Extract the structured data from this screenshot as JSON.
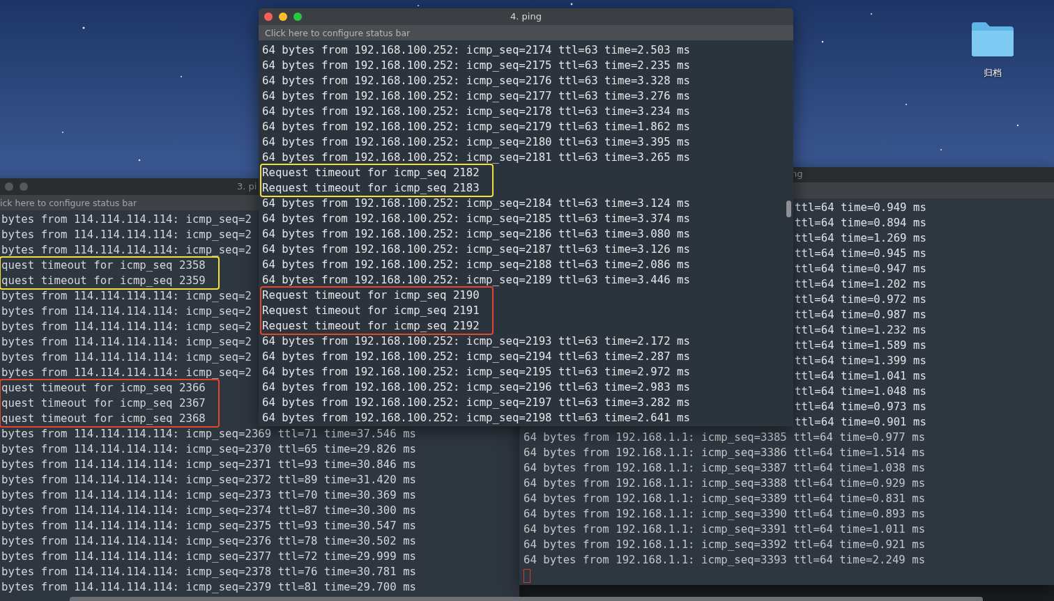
{
  "desktop": {
    "kind": "picture",
    "icons": [
      {
        "label": "归档"
      }
    ]
  },
  "windows": [
    {
      "title": "4. ping",
      "active": true,
      "status_bar": "Click here to configure status bar",
      "blocks": [
        {
          "lines": [
            "64 bytes from 192.168.100.252: icmp_seq=2174 ttl=63 time=2.503 ms",
            "64 bytes from 192.168.100.252: icmp_seq=2175 ttl=63 time=2.235 ms",
            "64 bytes from 192.168.100.252: icmp_seq=2176 ttl=63 time=3.328 ms",
            "64 bytes from 192.168.100.252: icmp_seq=2177 ttl=63 time=3.276 ms",
            "64 bytes from 192.168.100.252: icmp_seq=2178 ttl=63 time=3.234 ms",
            "64 bytes from 192.168.100.252: icmp_seq=2179 ttl=63 time=1.862 ms",
            "64 bytes from 192.168.100.252: icmp_seq=2180 ttl=63 time=3.395 ms",
            "64 bytes from 192.168.100.252: icmp_seq=2181 ttl=63 time=3.265 ms"
          ]
        },
        {
          "color": "#f2e13c",
          "lines": [
            "Request timeout for icmp_seq 2182",
            "Request timeout for icmp_seq 2183"
          ]
        },
        {
          "lines": [
            "64 bytes from 192.168.100.252: icmp_seq=2184 ttl=63 time=3.124 ms",
            "64 bytes from 192.168.100.252: icmp_seq=2185 ttl=63 time=3.374 ms",
            "64 bytes from 192.168.100.252: icmp_seq=2186 ttl=63 time=3.080 ms",
            "64 bytes from 192.168.100.252: icmp_seq=2187 ttl=63 time=3.126 ms",
            "64 bytes from 192.168.100.252: icmp_seq=2188 ttl=63 time=2.086 ms",
            "64 bytes from 192.168.100.252: icmp_seq=2189 ttl=63 time=3.446 ms"
          ]
        },
        {
          "color": "#e5462b",
          "lines": [
            "Request timeout for icmp_seq 2190",
            "Request timeout for icmp_seq 2191",
            "Request timeout for icmp_seq 2192"
          ]
        },
        {
          "lines": [
            "64 bytes from 192.168.100.252: icmp_seq=2193 ttl=63 time=2.172 ms",
            "64 bytes from 192.168.100.252: icmp_seq=2194 ttl=63 time=2.287 ms",
            "64 bytes from 192.168.100.252: icmp_seq=2195 ttl=63 time=2.972 ms",
            "64 bytes from 192.168.100.252: icmp_seq=2196 ttl=63 time=2.983 ms",
            "64 bytes from 192.168.100.252: icmp_seq=2197 ttl=63 time=3.282 ms",
            "64 bytes from 192.168.100.252: icmp_seq=2198 ttl=63 time=2.641 ms"
          ]
        }
      ]
    },
    {
      "title": "3. pi",
      "active": false,
      "status_bar": "ick here to configure status bar",
      "blocks": [
        {
          "lines": [
            "bytes from 114.114.114.114: icmp_seq=2",
            "bytes from 114.114.114.114: icmp_seq=2",
            "bytes from 114.114.114.114: icmp_seq=2"
          ]
        },
        {
          "color": "#f2e13c",
          "lines": [
            "quest timeout for icmp_seq 2358",
            "quest timeout for icmp_seq 2359"
          ]
        },
        {
          "lines": [
            "bytes from 114.114.114.114: icmp_seq=2",
            "bytes from 114.114.114.114: icmp_seq=2",
            "bytes from 114.114.114.114: icmp_seq=2",
            "bytes from 114.114.114.114: icmp_seq=2",
            "bytes from 114.114.114.114: icmp_seq=2",
            "bytes from 114.114.114.114: icmp_seq=2"
          ]
        },
        {
          "color": "#e5462b",
          "lines": [
            "quest timeout for icmp_seq 2366",
            "quest timeout for icmp_seq 2367",
            "quest timeout for icmp_seq 2368"
          ]
        },
        {
          "lines": [
            "bytes from 114.114.114.114: icmp_seq=2369 ttl=71 time=37.546 ms",
            "bytes from 114.114.114.114: icmp_seq=2370 ttl=65 time=29.826 ms",
            "bytes from 114.114.114.114: icmp_seq=2371 ttl=93 time=30.846 ms",
            "bytes from 114.114.114.114: icmp_seq=2372 ttl=89 time=31.420 ms",
            "bytes from 114.114.114.114: icmp_seq=2373 ttl=70 time=30.369 ms",
            "bytes from 114.114.114.114: icmp_seq=2374 ttl=87 time=30.300 ms",
            "bytes from 114.114.114.114: icmp_seq=2375 ttl=93 time=30.547 ms",
            "bytes from 114.114.114.114: icmp_seq=2376 ttl=78 time=30.502 ms",
            "bytes from 114.114.114.114: icmp_seq=2377 ttl=72 time=29.999 ms",
            "bytes from 114.114.114.114: icmp_seq=2378 ttl=76 time=30.781 ms",
            "bytes from 114.114.114.114: icmp_seq=2379 ttl=81 time=29.700 ms"
          ]
        }
      ]
    },
    {
      "title": "ng",
      "active": false,
      "blocks": [
        {
          "kind": "covered",
          "lines": [
            "ttl=64 time=0.949 ms",
            "ttl=64 time=0.894 ms",
            "ttl=64 time=1.269 ms",
            "ttl=64 time=0.945 ms",
            "ttl=64 time=0.947 ms",
            "ttl=64 time=1.202 ms",
            "ttl=64 time=0.972 ms",
            "ttl=64 time=0.987 ms",
            "ttl=64 time=1.232 ms",
            "ttl=64 time=1.589 ms",
            "ttl=64 time=1.399 ms",
            "ttl=64 time=1.041 ms",
            "ttl=64 time=1.048 ms",
            "ttl=64 time=0.973 ms",
            "ttl=64 time=0.901 ms"
          ]
        },
        {
          "kind": "full",
          "lines": [
            "64 bytes from 192.168.1.1: icmp_seq=3385 ttl=64 time=0.977 ms",
            "64 bytes from 192.168.1.1: icmp_seq=3386 ttl=64 time=1.514 ms",
            "64 bytes from 192.168.1.1: icmp_seq=3387 ttl=64 time=1.038 ms",
            "64 bytes from 192.168.1.1: icmp_seq=3388 ttl=64 time=0.929 ms",
            "64 bytes from 192.168.1.1: icmp_seq=3389 ttl=64 time=0.831 ms",
            "64 bytes from 192.168.1.1: icmp_seq=3390 ttl=64 time=0.893 ms",
            "64 bytes from 192.168.1.1: icmp_seq=3391 ttl=64 time=1.011 ms",
            "64 bytes from 192.168.1.1: icmp_seq=3392 ttl=64 time=0.921 ms",
            "64 bytes from 192.168.1.1: icmp_seq=3393 ttl=64 time=2.249 ms"
          ]
        }
      ],
      "cursor": true
    }
  ]
}
